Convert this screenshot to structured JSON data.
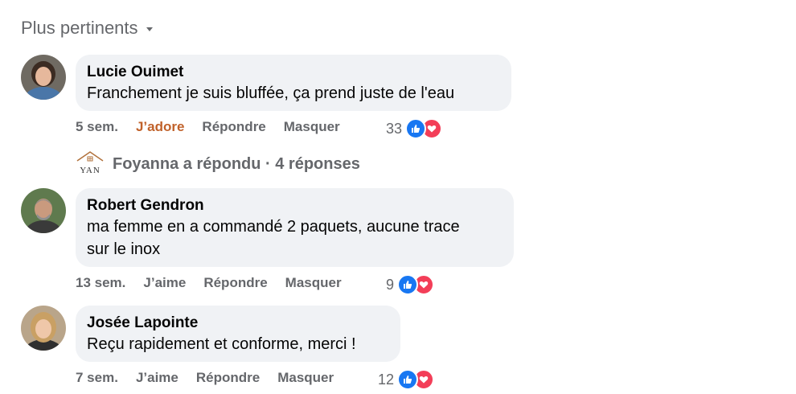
{
  "sort": {
    "label": "Plus pertinents"
  },
  "comments": [
    {
      "author": "Lucie Ouimet",
      "text": "Franchement je suis bluffée, ça prend juste de l'eau",
      "time": "5 sem.",
      "reaction_action": "J’adore",
      "reply_label": "Répondre",
      "hide_label": "Masquer",
      "reaction_count": "33"
    },
    {
      "author": "Robert Gendron",
      "text_lines": [
        "ma femme en a commandé 2 paquets, aucune trace",
        "sur le inox"
      ],
      "time": "13 sem.",
      "reaction_action": "J’aime",
      "reply_label": "Répondre",
      "hide_label": "Masquer",
      "reaction_count": "9"
    },
    {
      "author": "Josée Lapointe",
      "text": "Reçu rapidement et conforme, merci !",
      "time": "7 sem.",
      "reaction_action": "J’aime",
      "reply_label": "Répondre",
      "hide_label": "Masquer",
      "reaction_count": "12"
    }
  ],
  "replies_summary": {
    "text": "Foyanna a répondu · 4 réponses",
    "page_logo_text": "YAN"
  },
  "colors": {
    "bubble": "#f0f2f5",
    "muted": "#65676b",
    "adore": "#c0612a",
    "like": "#1877f2",
    "love": "#f33e58"
  }
}
